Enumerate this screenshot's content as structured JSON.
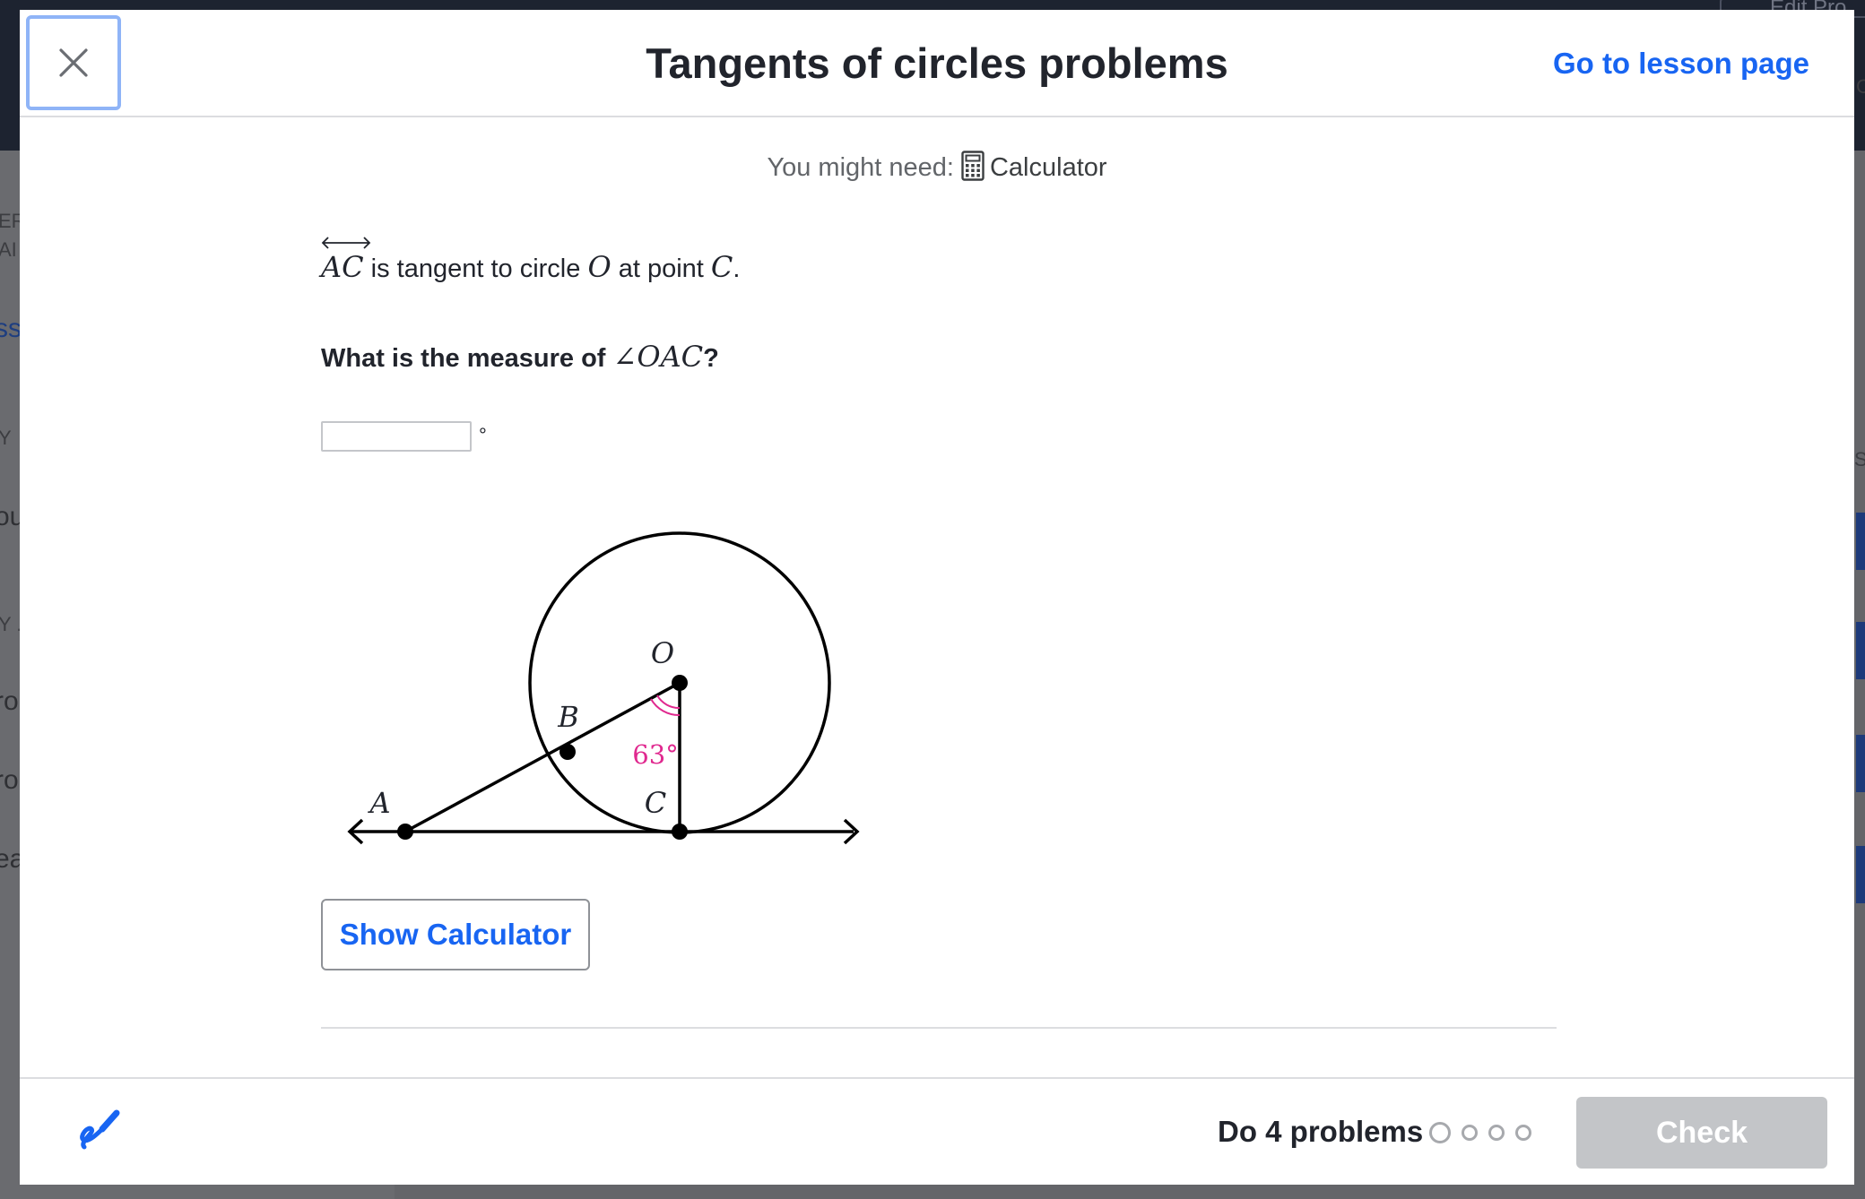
{
  "background": {
    "edit_fragment": "Edit Pro",
    "left_fragments": [
      "ER",
      "AI",
      "ss",
      "Y",
      "ou",
      "Y .",
      "ro",
      "ro",
      "ea"
    ],
    "right_fragments": [
      "S",
      "C"
    ]
  },
  "header": {
    "title": "Tangents of circles problems",
    "lesson_link": "Go to lesson page"
  },
  "tools": {
    "label": "You might need:",
    "calculator_label": "Calculator"
  },
  "question": {
    "line_AC": "AC",
    "text_1": " is tangent to circle ",
    "circle": "O",
    "text_2": " at point ",
    "point": "C",
    "text_3": ".",
    "prompt_text": "What is the measure of ",
    "prompt_angle": "∠OAC",
    "prompt_end": "?"
  },
  "answer": {
    "value": "",
    "unit": "°"
  },
  "figure": {
    "labels": {
      "O": "O",
      "A": "A",
      "B": "B",
      "C": "C"
    },
    "angle_label": "63°",
    "angle_color": "#e0298f"
  },
  "buttons": {
    "show_calculator": "Show Calculator",
    "check": "Check"
  },
  "footer": {
    "do_problems": "Do 4 problems",
    "problem_count": 4,
    "current_problem": 1
  },
  "colors": {
    "accent": "#1865f2",
    "text": "#21242c",
    "disabled_button": "#c3c5c8"
  }
}
